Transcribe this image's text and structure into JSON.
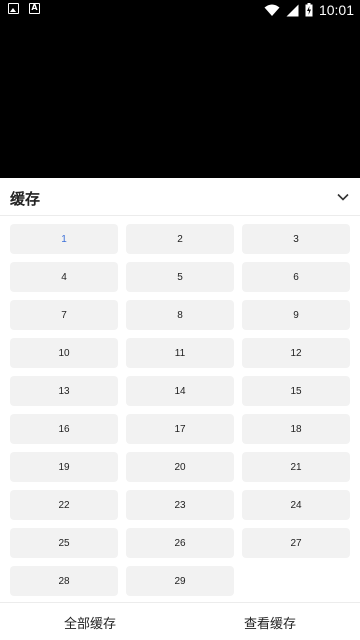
{
  "status_bar": {
    "time": "10:01",
    "notification_icons": [
      "image-icon",
      "a-icon"
    ],
    "system_icons": [
      "wifi-icon",
      "cell-signal-icon",
      "battery-charging-icon"
    ]
  },
  "sheet": {
    "title": "缓存",
    "collapse_icon": "chevron-down-icon",
    "current_episode": "1",
    "episodes": [
      "1",
      "2",
      "3",
      "4",
      "5",
      "6",
      "7",
      "8",
      "9",
      "10",
      "11",
      "12",
      "13",
      "14",
      "15",
      "16",
      "17",
      "18",
      "19",
      "20",
      "21",
      "22",
      "23",
      "24",
      "25",
      "26",
      "27",
      "28",
      "29"
    ]
  },
  "footer": {
    "download_all_label": "全部缓存",
    "view_cache_label": "查看缓存"
  },
  "colors": {
    "accent": "#3b6fd8",
    "tile_bg": "#f2f2f2"
  }
}
